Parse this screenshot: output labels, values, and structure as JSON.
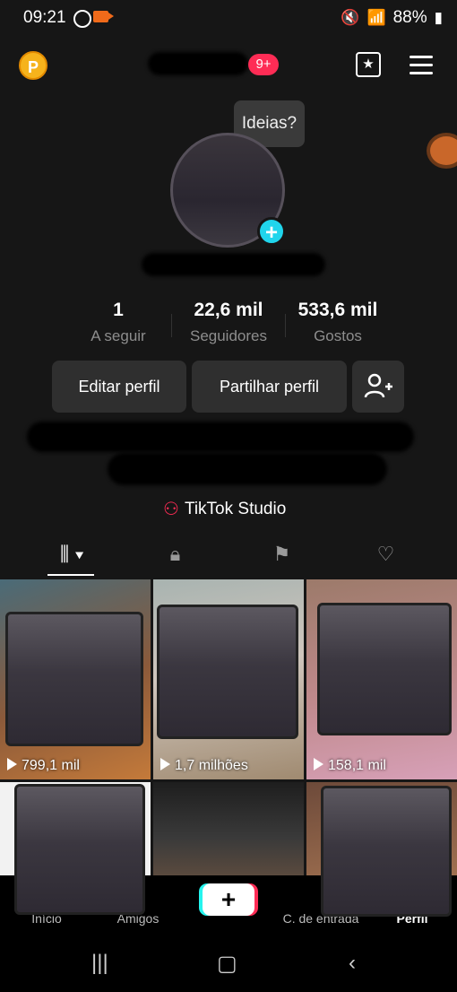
{
  "status": {
    "time": "09:21",
    "battery": "88%",
    "icons": [
      "whatsapp-icon",
      "recorder-icon",
      "mute-icon",
      "wifi-icon",
      "signal-icon",
      "volte-icon",
      "signal-icon",
      "battery-icon"
    ]
  },
  "header": {
    "coin": "P",
    "notification_count": "9+"
  },
  "profile": {
    "tooltip": "Ideias?",
    "stats": [
      {
        "value": "1",
        "label": "A seguir"
      },
      {
        "value": "22,6 mil",
        "label": "Seguidores"
      },
      {
        "value": "533,6 mil",
        "label": "Gostos"
      }
    ],
    "buttons": {
      "edit": "Editar perfil",
      "share": "Partilhar perfil"
    },
    "studio_label": "TikTok Studio"
  },
  "tabs": [
    "videos-grid-icon",
    "lock-icon",
    "repost-icon",
    "liked-icon"
  ],
  "videos": [
    {
      "views": "799,1 mil"
    },
    {
      "views": "1,7 milhões"
    },
    {
      "views": "158,1 mil"
    },
    {
      "views": ""
    },
    {
      "views": ""
    },
    {
      "views": ""
    }
  ],
  "bottom_nav": {
    "home": "Início",
    "friends": "Amigos",
    "inbox": "C. de entrada",
    "profile": "Perfil"
  },
  "colors": {
    "accent": "#fe2c55",
    "cyan": "#20d5ec",
    "coin": "#f6b31c"
  }
}
